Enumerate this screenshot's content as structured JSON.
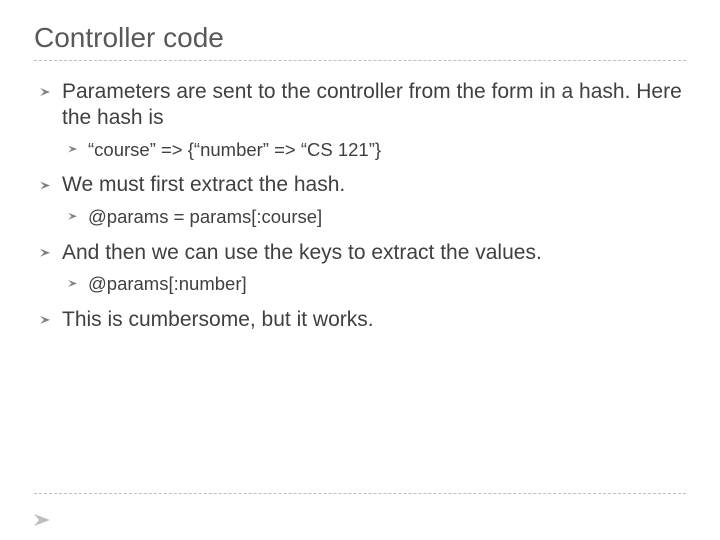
{
  "title": "Controller code",
  "bullets": [
    {
      "text": "Parameters are sent to the controller from the form in a hash.  Here the hash is",
      "sub": [
        "“course” => {“number” => “CS 121”}"
      ]
    },
    {
      "text": "We must first extract the hash.",
      "sub": [
        "@params = params[:course]"
      ]
    },
    {
      "text": "And then we can use the keys to extract the values.",
      "sub": [
        "@params[:number]"
      ]
    },
    {
      "text": "This is cumbersome, but it works.",
      "sub": []
    }
  ]
}
